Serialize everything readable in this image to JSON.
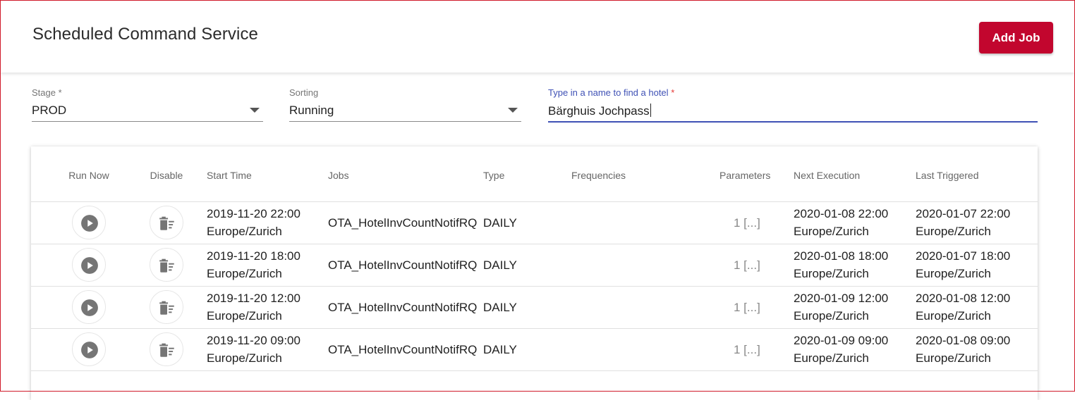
{
  "app": {
    "title": "Scheduled Command Service",
    "add_job_label": "Add Job"
  },
  "filters": {
    "stage": {
      "label": "Stage *",
      "value": "PROD"
    },
    "sorting": {
      "label": "Sorting",
      "value": "Running"
    },
    "hotel": {
      "label": "Type in a name to find a hotel",
      "required_mark": "*",
      "value": "Bärghuis Jochpass"
    }
  },
  "table": {
    "headers": {
      "run_now": "Run Now",
      "disable": "Disable",
      "start_time": "Start Time",
      "jobs": "Jobs",
      "type": "Type",
      "frequencies": "Frequencies",
      "parameters": "Parameters",
      "next_execution": "Next Execution",
      "last_triggered": "Last Triggered"
    },
    "rows": [
      {
        "start_date": "2019-11-20 22:00",
        "start_tz": "Europe/Zurich",
        "job": "OTA_HotelInvCountNotifRQ",
        "type": "DAILY",
        "frequencies": "",
        "parameters": "1 [...]",
        "next_date": "2020-01-08 22:00",
        "next_tz": "Europe/Zurich",
        "last_date": "2020-01-07 22:00",
        "last_tz": "Europe/Zurich"
      },
      {
        "start_date": "2019-11-20 18:00",
        "start_tz": "Europe/Zurich",
        "job": "OTA_HotelInvCountNotifRQ",
        "type": "DAILY",
        "frequencies": "",
        "parameters": "1 [...]",
        "next_date": "2020-01-08 18:00",
        "next_tz": "Europe/Zurich",
        "last_date": "2020-01-07 18:00",
        "last_tz": "Europe/Zurich"
      },
      {
        "start_date": "2019-11-20 12:00",
        "start_tz": "Europe/Zurich",
        "job": "OTA_HotelInvCountNotifRQ",
        "type": "DAILY",
        "frequencies": "",
        "parameters": "1 [...]",
        "next_date": "2020-01-09 12:00",
        "next_tz": "Europe/Zurich",
        "last_date": "2020-01-08 12:00",
        "last_tz": "Europe/Zurich"
      },
      {
        "start_date": "2019-11-20 09:00",
        "start_tz": "Europe/Zurich",
        "job": "OTA_HotelInvCountNotifRQ",
        "type": "DAILY",
        "frequencies": "",
        "parameters": "1 [...]",
        "next_date": "2020-01-09 09:00",
        "next_tz": "Europe/Zurich",
        "last_date": "2020-01-08 09:00",
        "last_tz": "Europe/Zurich"
      }
    ]
  },
  "icons": {
    "run": "play-circle-icon",
    "disable": "delete-sweep-icon",
    "dropdown": "caret-down-icon"
  },
  "colors": {
    "primary": "#c2062e",
    "focus": "#3f51b5",
    "required": "#e53935",
    "icon": "#757575"
  }
}
